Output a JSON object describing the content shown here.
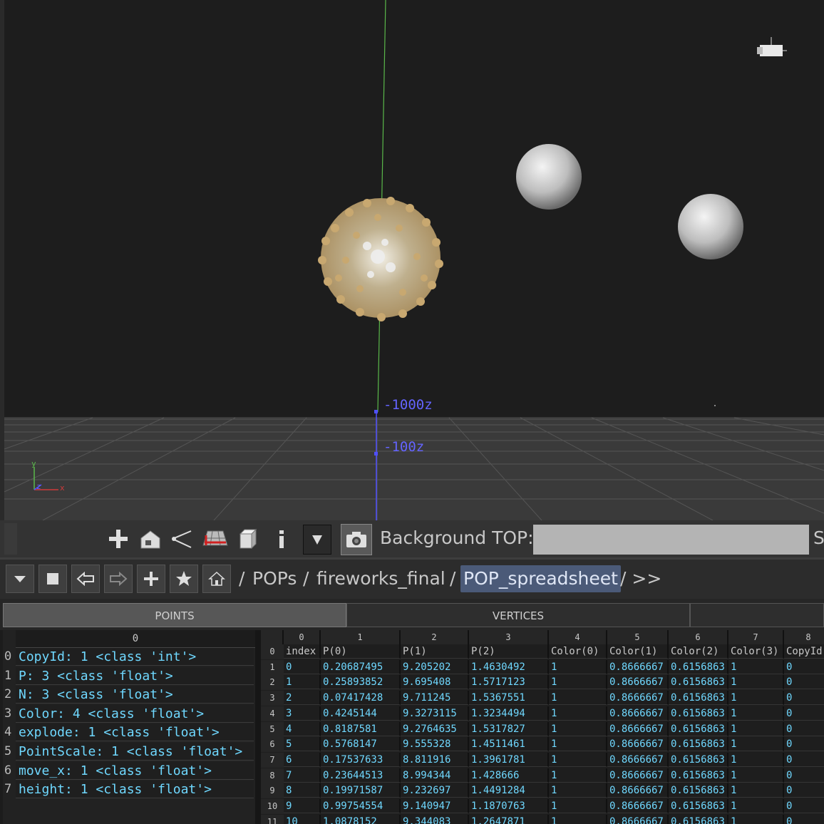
{
  "viewport": {
    "axis_labels": [
      "-1000z",
      "-100z"
    ],
    "gizmo": {
      "x": "x",
      "y": "y",
      "z": "z"
    },
    "colors": {
      "background": "#1d1d1d",
      "y_axis": "#5ab84a",
      "z_axis": "#5050ff",
      "particles": "#c8a870"
    }
  },
  "toolbar": {
    "icons": [
      "crosshair-icon",
      "home-icon",
      "view-angle-icon",
      "grid-icon",
      "cube-icon",
      "info-icon",
      "dropdown-triangle-icon",
      "camera-icon"
    ],
    "background_top_label": "Background TOP:",
    "background_top_value": "",
    "clipped_label": "S"
  },
  "pathbar": {
    "crumbs": [
      {
        "sep": "/",
        "label": "POPs"
      },
      {
        "sep": "/",
        "label": "fireworks_final"
      },
      {
        "sep": "/",
        "label": "POP_spreadsheet"
      }
    ],
    "trailing": "/ >>"
  },
  "tabs": [
    "POINTS",
    "VERTICES",
    ""
  ],
  "attributes": {
    "header": "0",
    "rows": [
      "CopyId: 1 <class 'int'>",
      "P: 3 <class 'float'>",
      "N: 3 <class 'float'>",
      "Color: 4 <class 'float'>",
      "explode: 1 <class 'float'>",
      "PointScale: 1 <class 'float'>",
      "move_x: 1 <class 'float'>",
      "height: 1 <class 'float'>"
    ]
  },
  "spreadsheet": {
    "col_numbers": [
      "0",
      "1",
      "2",
      "3",
      "4",
      "5",
      "6",
      "7",
      "8"
    ],
    "row_numbers": [
      "0",
      "1",
      "2",
      "3",
      "4",
      "5",
      "6",
      "7",
      "8",
      "9",
      "10",
      "11"
    ],
    "headers": [
      "index",
      "P(0)",
      "P(1)",
      "P(2)",
      "Color(0)",
      "Color(1)",
      "Color(2)",
      "Color(3)",
      "CopyId"
    ],
    "rows": [
      [
        "0",
        "0.20687495",
        "9.205202",
        "1.4630492",
        "1",
        "0.8666667",
        "0.6156863",
        "1",
        "0"
      ],
      [
        "1",
        "0.25893852",
        "9.695408",
        "1.5717123",
        "1",
        "0.8666667",
        "0.6156863",
        "1",
        "0"
      ],
      [
        "2",
        "0.07417428",
        "9.711245",
        "1.5367551",
        "1",
        "0.8666667",
        "0.6156863",
        "1",
        "0"
      ],
      [
        "3",
        "0.4245144",
        "9.3273115",
        "1.3234494",
        "1",
        "0.8666667",
        "0.6156863",
        "1",
        "0"
      ],
      [
        "4",
        "0.8187581",
        "9.2764635",
        "1.5317827",
        "1",
        "0.8666667",
        "0.6156863",
        "1",
        "0"
      ],
      [
        "5",
        "0.5768147",
        "9.555328",
        "1.4511461",
        "1",
        "0.8666667",
        "0.6156863",
        "1",
        "0"
      ],
      [
        "6",
        "0.17537633",
        "8.811916",
        "1.3961781",
        "1",
        "0.8666667",
        "0.6156863",
        "1",
        "0"
      ],
      [
        "7",
        "0.23644513",
        "8.994344",
        "1.428666",
        "1",
        "0.8666667",
        "0.6156863",
        "1",
        "0"
      ],
      [
        "8",
        "0.19971587",
        "9.232697",
        "1.4491284",
        "1",
        "0.8666667",
        "0.6156863",
        "1",
        "0"
      ],
      [
        "9",
        "0.99754554",
        "9.140947",
        "1.1870763",
        "1",
        "0.8666667",
        "0.6156863",
        "1",
        "0"
      ],
      [
        "10",
        "1.0878152",
        "9.344083",
        "1.2647871",
        "1",
        "0.8666667",
        "0.6156863",
        "1",
        "0"
      ]
    ]
  }
}
